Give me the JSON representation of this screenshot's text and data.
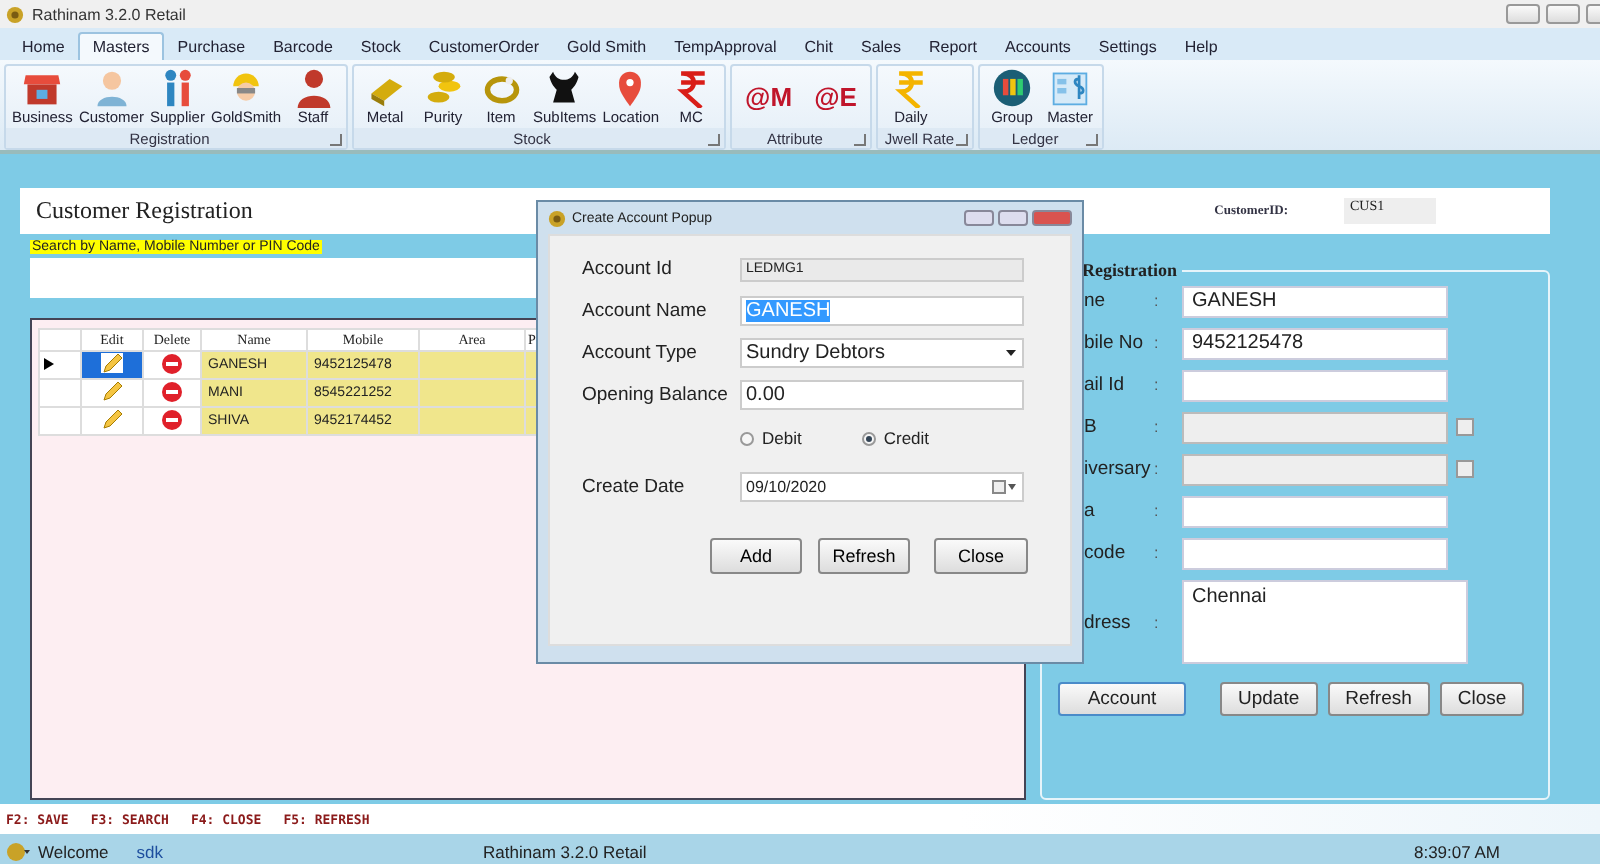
{
  "window": {
    "title": "Rathinam 3.2.0 Retail"
  },
  "menu": [
    {
      "label": "Home",
      "selected": false
    },
    {
      "label": "Masters",
      "selected": true
    },
    {
      "label": "Purchase",
      "selected": false
    },
    {
      "label": "Barcode",
      "selected": false
    },
    {
      "label": "Stock",
      "selected": false
    },
    {
      "label": "CustomerOrder",
      "selected": false
    },
    {
      "label": "Gold Smith",
      "selected": false
    },
    {
      "label": "TempApproval",
      "selected": false
    },
    {
      "label": "Chit",
      "selected": false
    },
    {
      "label": "Sales",
      "selected": false
    },
    {
      "label": "Report",
      "selected": false
    },
    {
      "label": "Accounts",
      "selected": false
    },
    {
      "label": "Settings",
      "selected": false
    },
    {
      "label": "Help",
      "selected": false
    }
  ],
  "ribbon": {
    "groups": [
      {
        "label": "Registration",
        "items": [
          {
            "kind": "icon",
            "label": "Business"
          },
          {
            "kind": "icon",
            "label": "Customer"
          },
          {
            "kind": "icon",
            "label": "Supplier"
          },
          {
            "kind": "icon",
            "label": "GoldSmith"
          },
          {
            "kind": "icon",
            "label": "Staff"
          }
        ]
      },
      {
        "label": "Stock",
        "items": [
          {
            "kind": "icon",
            "label": "Metal"
          },
          {
            "kind": "icon",
            "label": "Purity"
          },
          {
            "kind": "icon",
            "label": "Item"
          },
          {
            "kind": "icon",
            "label": "SubItems"
          },
          {
            "kind": "icon",
            "label": "Location"
          },
          {
            "kind": "icon",
            "label": "MC"
          }
        ]
      },
      {
        "label": "Attribute",
        "items": [
          {
            "kind": "glyph",
            "glyph": "@M"
          },
          {
            "kind": "glyph",
            "glyph": "@E"
          }
        ]
      },
      {
        "label": "Jwell Rate",
        "items": [
          {
            "kind": "icon",
            "label": "Daily"
          }
        ]
      },
      {
        "label": "Ledger",
        "items": [
          {
            "kind": "icon",
            "label": "Group"
          },
          {
            "kind": "icon",
            "label": "Master"
          }
        ]
      }
    ]
  },
  "form": {
    "title": "Customer Registration",
    "customer_id_label": "CustomerID:",
    "customer_id": "CUS1",
    "search_hint": "Search by Name, Mobile Number or PIN Code"
  },
  "grid": {
    "columns": [
      "Edit",
      "Delete",
      "Name",
      "Mobile",
      "Area",
      "P"
    ],
    "rows": [
      {
        "selected": true,
        "name": "GANESH",
        "mobile": "9452125478"
      },
      {
        "selected": false,
        "name": "MANI",
        "mobile": "8545221252"
      },
      {
        "selected": false,
        "name": "SHIVA",
        "mobile": "9452174452"
      }
    ]
  },
  "registration": {
    "title": "Registration",
    "fields": [
      {
        "kind": "text",
        "label": "ne",
        "separator": ":",
        "value": "GANESH"
      },
      {
        "kind": "text",
        "label": "bile No",
        "separator": ":",
        "value": "9452125478"
      },
      {
        "kind": "text",
        "label": "ail Id",
        "separator": ":"
      },
      {
        "kind": "date",
        "label": "B",
        "separator": ":",
        "disabled": true,
        "checked": false
      },
      {
        "kind": "date",
        "label": "iversary",
        "separator": ":",
        "disabled": true,
        "checked": false
      },
      {
        "kind": "text",
        "label": "a",
        "separator": ":"
      },
      {
        "kind": "text",
        "label": "code",
        "separator": ":"
      },
      {
        "kind": "textarea",
        "label": "dress",
        "separator": ":",
        "value": "Chennai"
      }
    ],
    "buttons": [
      "Account",
      "Update",
      "Refresh",
      "Close"
    ]
  },
  "popup": {
    "title": "Create Account Popup",
    "fields": [
      {
        "kind": "readonly",
        "label": "Account Id",
        "value": "LEDMG1"
      },
      {
        "kind": "text",
        "label": "Account Name",
        "value": "GANESH",
        "text_selected": true
      },
      {
        "kind": "dropdown",
        "label": "Account Type",
        "value": "Sundry Debtors"
      },
      {
        "kind": "text",
        "label": "Opening Balance",
        "value": "0.00"
      },
      {
        "kind": "radios",
        "options": [
          {
            "label": "Debit",
            "selected": false
          },
          {
            "label": "Credit",
            "selected": true
          }
        ]
      },
      {
        "kind": "date",
        "label": "Create Date",
        "value": "09/10/2020"
      }
    ],
    "buttons": [
      "Add",
      "Refresh",
      "Close"
    ]
  },
  "shortcuts": [
    "F2: SAVE",
    "F3: SEARCH",
    "F4: CLOSE",
    "F5: REFRESH"
  ],
  "status_bar": {
    "welcome": "Welcome",
    "user": "sdk",
    "app": "Rathinam 3.2.0 Retail",
    "time": "8:39:07 AM"
  }
}
